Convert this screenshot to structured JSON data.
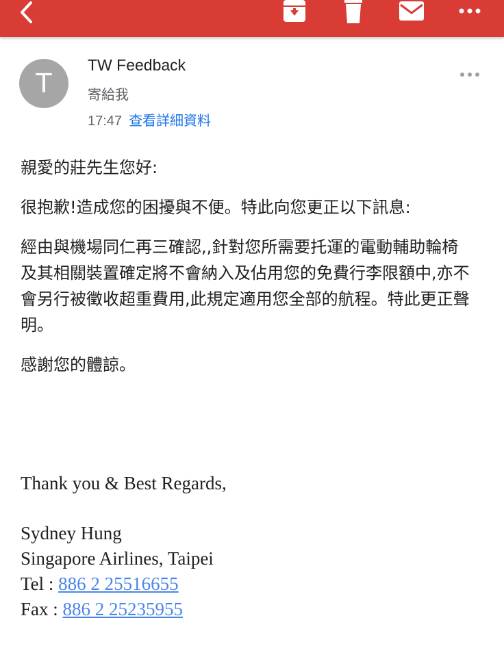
{
  "toolbar": {
    "icons": [
      "back-arrow-icon",
      "archive-icon",
      "trash-icon",
      "mail-icon",
      "more-icon"
    ],
    "bar_color": "#d93b35"
  },
  "message": {
    "avatar_letter": "T",
    "sender_name": "TW Feedback",
    "recipient_line": "寄給我",
    "time": "17:47",
    "details_link": "查看詳細資料"
  },
  "body": {
    "greeting": "親愛的莊先生您好:",
    "para1": "很抱歉!造成您的困擾與不便。特此向您更正以下訊息:",
    "para2": "經由與機場同仁再三確認,,針對您所需要托運的電動輔助輪椅及其相關裝置確定將不會納入及佔用您的免費行李限額中,亦不會另行被徵收超重費用,此規定適用您全部的航程。特此更正聲明。",
    "para3": "感謝您的體諒。"
  },
  "signature": {
    "closing": "Thank you & Best Regards,",
    "name": "Sydney Hung",
    "company": "Singapore Airlines, Taipei",
    "tel_label": "Tel : ",
    "tel_number": "886 2 25516655",
    "fax_label": "Fax : ",
    "fax_number": "886 2 25235955"
  },
  "colors": {
    "link": "#1a73e8",
    "phone_link": "#4a86e8",
    "avatar_bg": "#a6a6a6"
  }
}
